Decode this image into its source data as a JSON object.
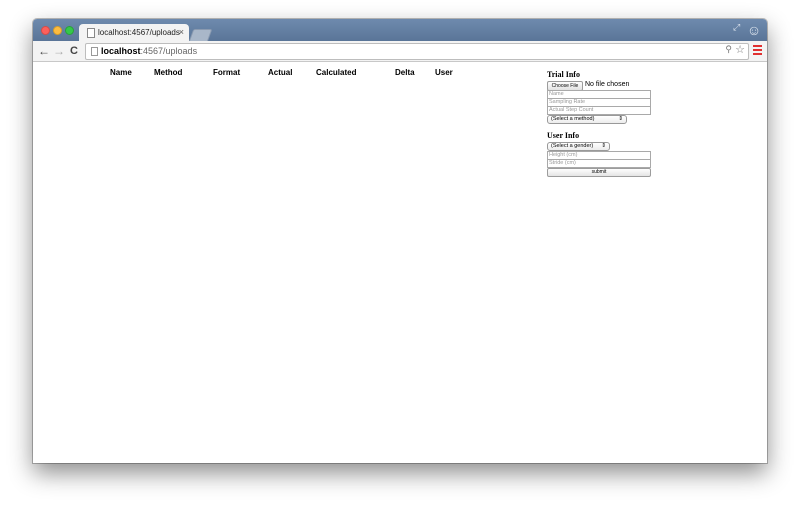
{
  "browser": {
    "tab_title": "localhost:4567/uploads",
    "tab_close": "×",
    "url_host": "localhost",
    "url_rest": ":4567/uploads",
    "nav_back": "←",
    "nav_forward": "→",
    "nav_reload": "C"
  },
  "table": {
    "columns": [
      "Name",
      "Method",
      "Format",
      "Actual",
      "Calculated",
      "Delta",
      "User"
    ]
  },
  "trial_info": {
    "title": "Trial Info",
    "choose_file_label": "Choose File",
    "file_status": "No file chosen",
    "name_placeholder": "Name",
    "sampling_rate_placeholder": "Sampling Rate",
    "actual_step_count_placeholder": "Actual Step Count",
    "method_select": "(Select a method)"
  },
  "user_info": {
    "title": "User Info",
    "gender_select": "(Select a gender)",
    "height_placeholder": "Height (cm)",
    "stride_placeholder": "Stride (cm)",
    "submit_label": "submit"
  },
  "colors": {
    "titlebar": "#6e8aae",
    "menu_accent": "#e03030"
  }
}
